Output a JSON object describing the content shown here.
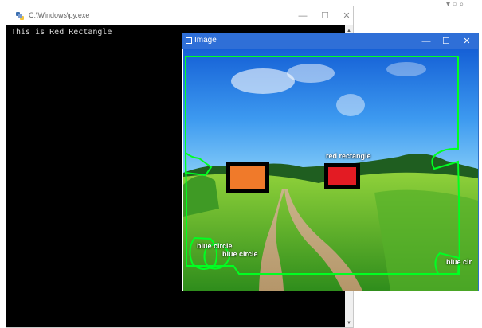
{
  "console": {
    "title": "C:\\Windows\\py.exe",
    "output": "This is Red Rectangle",
    "min_glyph": "—",
    "max_glyph": "☐",
    "close_glyph": "✕",
    "scroll_up_glyph": "▲",
    "scroll_down_glyph": "▼"
  },
  "image_window": {
    "title": "Image",
    "min_glyph": "—",
    "max_glyph": "☐",
    "close_glyph": "✕"
  },
  "scene": {
    "labels": {
      "red_rectangle": "red rectangle",
      "blue_circle_1": "blue circle",
      "blue_circle_2": "blue circle",
      "blue_circle_3": "blue cir"
    },
    "colors": {
      "contour": "#00ff22",
      "orange_rect": "#f07a2a",
      "red_rect": "#e31b23",
      "rect_border": "#000000",
      "titlebar": "#2f6fd7"
    }
  },
  "background": {
    "topright_glyphs": "▾ ○ ⌕"
  }
}
